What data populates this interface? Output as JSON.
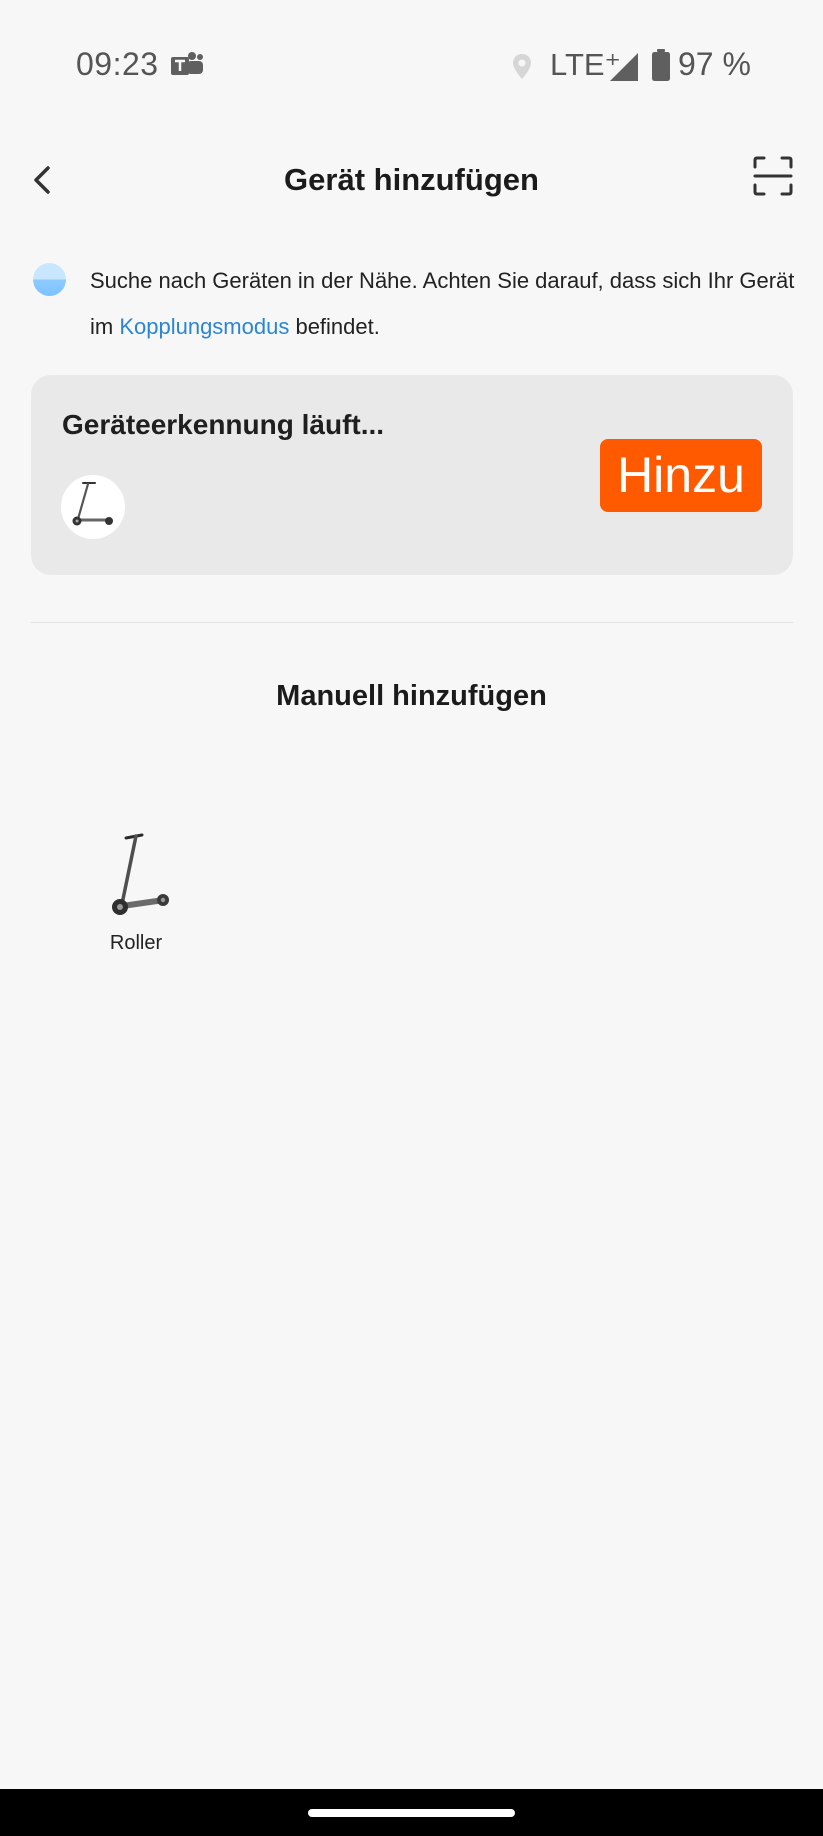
{
  "status_bar": {
    "time": "09:23",
    "network": "LTE⁺",
    "battery": "97 %",
    "battery_percent": 97,
    "icons": [
      "teams-icon",
      "location-icon",
      "signal-icon",
      "battery-icon"
    ]
  },
  "header": {
    "title": "Gerät hinzufügen",
    "back_icon": "chevron-left-icon",
    "scan_icon": "scan-icon"
  },
  "hint": {
    "text_before": "Suche nach Geräten in der Nähe. Achten Sie darauf, dass sich Ihr Gerät im ",
    "link": "Kopplungsmodus",
    "text_after": " befindet."
  },
  "discovery": {
    "title": "Geräteerkennung läuft...",
    "device_icon": "scooter-icon",
    "add_button": "Hinzu"
  },
  "manual": {
    "title": "Manuell hinzufügen",
    "categories": [
      {
        "label": "Roller",
        "icon": "scooter-icon"
      }
    ]
  },
  "colors": {
    "background": "#f7f7f7",
    "card": "#e9e9e9",
    "accent": "#ff5a00",
    "link": "#2a86d5",
    "text": "#1f1f1f"
  }
}
